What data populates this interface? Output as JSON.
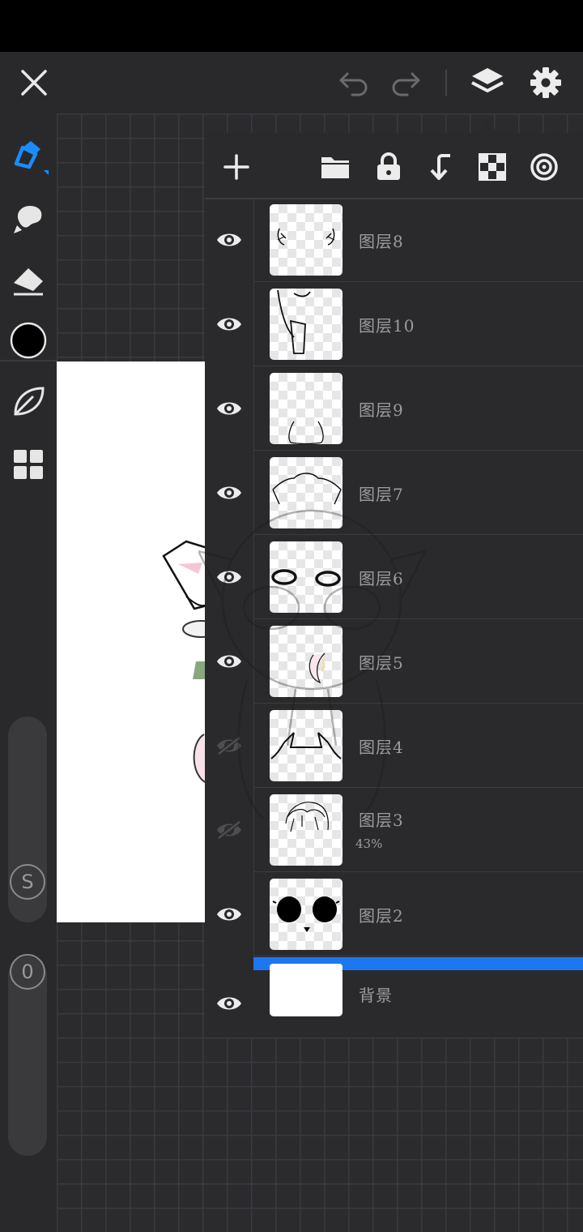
{
  "toolbar_top": {
    "close_icon": "close-icon",
    "undo_icon": "undo-icon",
    "redo_icon": "redo-icon",
    "layers_icon": "layers-icon",
    "settings_icon": "gear-icon"
  },
  "tools": {
    "brush_color": "#1a8cff",
    "current_color": "#000000",
    "size_label": "S",
    "opacity_label": "0"
  },
  "layers_panel": {
    "actions": [
      "add-layer",
      "folder",
      "lock",
      "merge-down",
      "transparency",
      "clipping"
    ],
    "layers": [
      {
        "name": "图层8",
        "visible": true
      },
      {
        "name": "图层10",
        "visible": true
      },
      {
        "name": "图层9",
        "visible": true
      },
      {
        "name": "图层7",
        "visible": true
      },
      {
        "name": "图层6",
        "visible": true
      },
      {
        "name": "图层5",
        "visible": true
      },
      {
        "name": "图层4",
        "visible": false
      },
      {
        "name": "图层3",
        "visible": false,
        "opacity": "43%"
      },
      {
        "name": "图层2",
        "visible": true
      },
      {
        "name": "背景",
        "visible": true
      }
    ],
    "selection_color": "#1b78f0"
  }
}
